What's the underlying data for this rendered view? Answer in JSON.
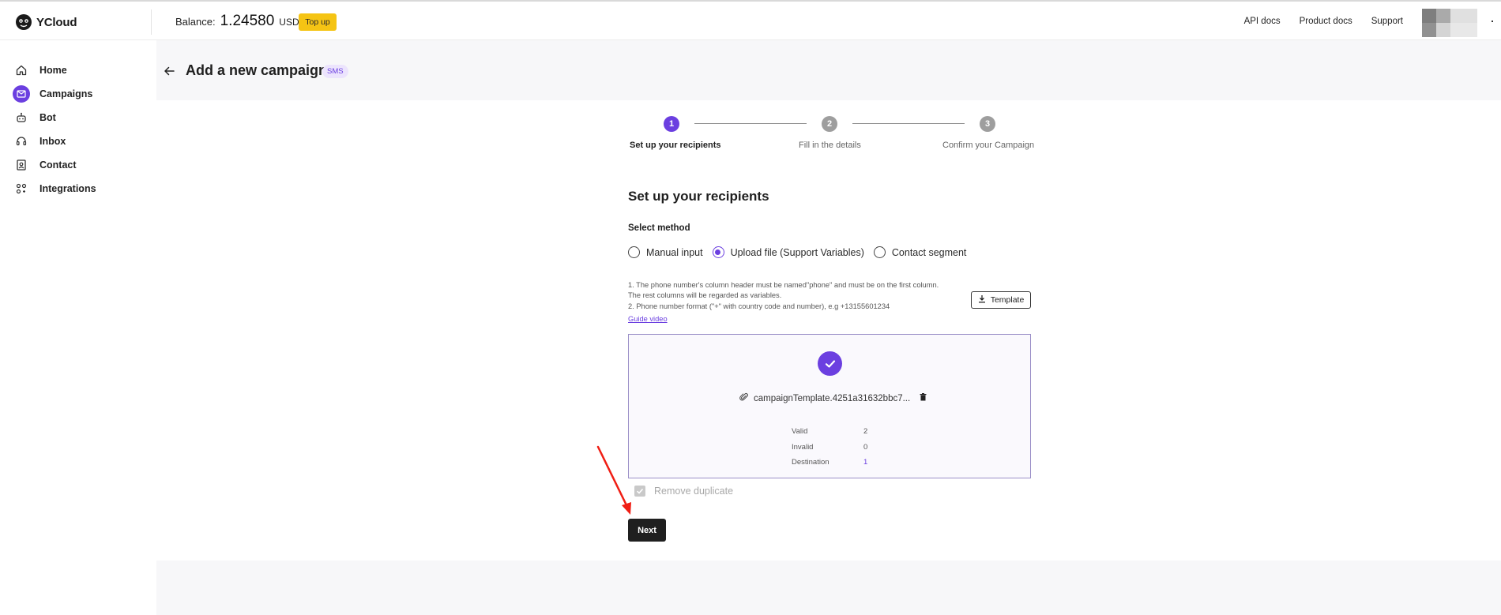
{
  "app": {
    "name": "YCloud"
  },
  "header": {
    "balance_label": "Balance:",
    "balance_amount": "1.24580",
    "balance_currency": "USD",
    "topup_label": "Top up",
    "links": [
      "API docs",
      "Product docs",
      "Support"
    ]
  },
  "sidebar": {
    "items": [
      {
        "label": "Home",
        "icon": "home-icon",
        "active": false
      },
      {
        "label": "Campaigns",
        "icon": "campaign-icon",
        "active": true
      },
      {
        "label": "Bot",
        "icon": "bot-icon",
        "active": false
      },
      {
        "label": "Inbox",
        "icon": "headset-icon",
        "active": false
      },
      {
        "label": "Contact",
        "icon": "contact-icon",
        "active": false
      },
      {
        "label": "Integrations",
        "icon": "integrations-icon",
        "active": false
      }
    ]
  },
  "page": {
    "title": "Add a new campaign",
    "badge": "SMS"
  },
  "stepper": {
    "steps": [
      {
        "number": "1",
        "label": "Set up your recipients",
        "active": true
      },
      {
        "number": "2",
        "label": "Fill in the details",
        "active": false
      },
      {
        "number": "3",
        "label": "Confirm your Campaign",
        "active": false
      }
    ]
  },
  "recipients": {
    "title": "Set up your recipients",
    "method_label": "Select method",
    "methods": [
      {
        "label": "Manual input",
        "checked": false
      },
      {
        "label": "Upload file (Support Variables)",
        "checked": true
      },
      {
        "label": "Contact segment",
        "checked": false
      }
    ],
    "instructions": [
      "1. The phone number's column header must be named\"phone\" and must be on the first column.",
      "The rest columns will be regarded as variables.",
      "2. Phone number format (\"+\" with country code and number), e.g +13155601234"
    ],
    "guide_link": "Guide video",
    "template_button": "Template",
    "file_name": "campaignTemplate.4251a31632bbc7...",
    "stats": [
      {
        "label": "Valid",
        "value": "2",
        "link": false
      },
      {
        "label": "Invalid",
        "value": "0",
        "link": false
      },
      {
        "label": "Destination",
        "value": "1",
        "link": true
      }
    ],
    "remove_duplicate_label": "Remove duplicate",
    "remove_duplicate_checked": true,
    "next_button": "Next"
  },
  "colors": {
    "accent": "#6b3fe0",
    "topup": "#f5c414",
    "annotation_arrow": "#f01e14"
  }
}
